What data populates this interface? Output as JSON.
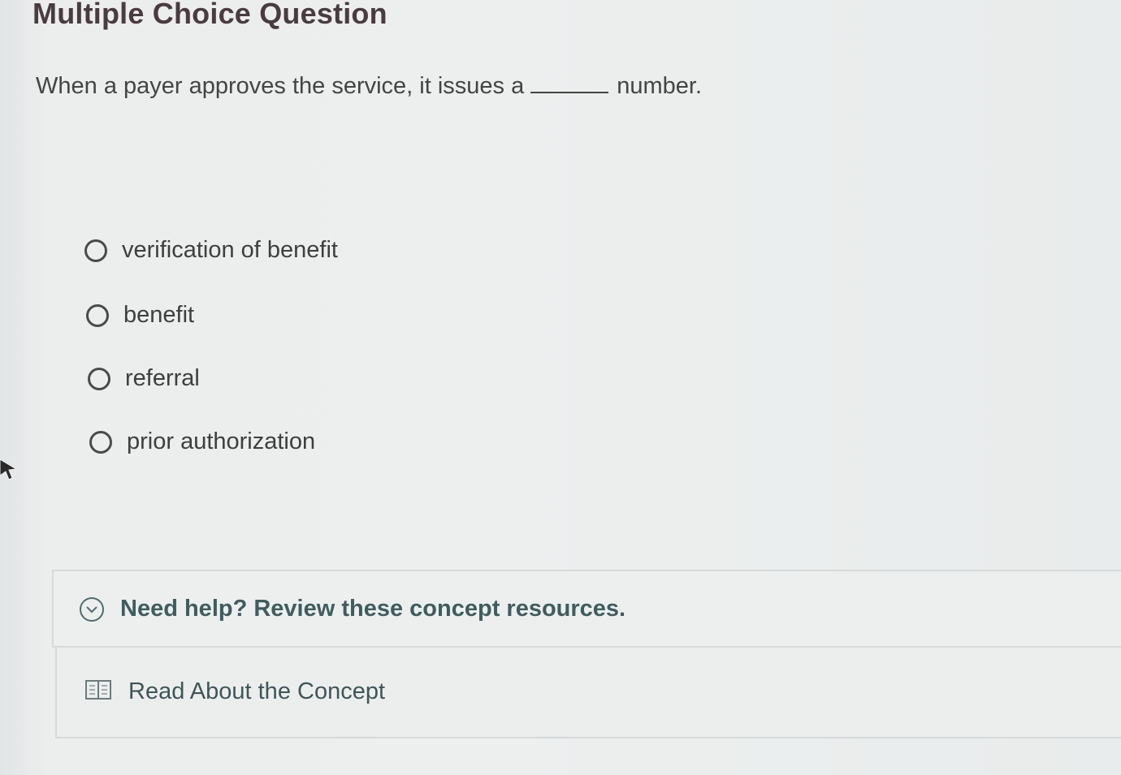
{
  "question": {
    "heading": "Multiple Choice Question",
    "text_before": "When a payer approves the service, it issues a",
    "text_after": "number."
  },
  "options": [
    {
      "label": "verification of benefit"
    },
    {
      "label": "benefit"
    },
    {
      "label": "referral"
    },
    {
      "label": "prior authorization"
    }
  ],
  "help": {
    "label": "Need help? Review these concept resources."
  },
  "resources": {
    "read_label": "Read About the Concept"
  },
  "colors": {
    "heading": "#4a3b3f",
    "help_text": "#3f5d5f",
    "background": "#eceeee"
  },
  "icons": [
    "chevron-down-icon",
    "book-icon",
    "mouse-cursor-icon"
  ]
}
